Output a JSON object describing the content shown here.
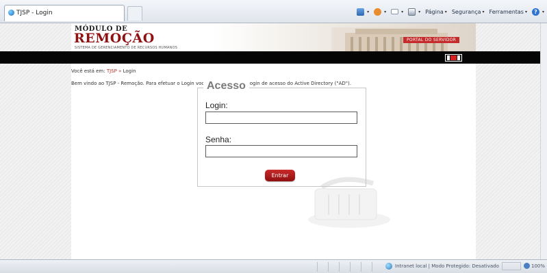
{
  "browser": {
    "tab_title": "TJSP - Login",
    "commands": [
      {
        "icon": "home-icon",
        "label": ""
      },
      {
        "icon": "feed-icon",
        "label": ""
      },
      {
        "icon": "mail-icon",
        "label": ""
      },
      {
        "icon": "print-icon",
        "label": ""
      },
      {
        "icon": "page-menu",
        "label": "Página"
      },
      {
        "icon": "security-menu",
        "label": "Segurança"
      },
      {
        "icon": "tools-menu",
        "label": "Ferramentas"
      },
      {
        "icon": "help-icon",
        "label": ""
      }
    ],
    "status": {
      "zone": "Intranet local | Modo Protegido: Desativado",
      "zoom": "100%"
    }
  },
  "header": {
    "logo_top": "MÓDULO DE",
    "logo_main": "REMOÇÃO",
    "logo_sub": "SISTEMA DE GERENCIAMENTO DE RECURSOS HUMANOS",
    "portal_badge": "PORTAL DO SERVIDOR"
  },
  "breadcrumb": {
    "prefix": "Você está em:",
    "link": "TJSP",
    "separator": "»",
    "current": "Login"
  },
  "welcome_text": "Bem vindo ao TJSP - Remoção. Para efetuar o Login você deve usar o seu login de acesso do Active Directory (\"AD\").",
  "login_form": {
    "legend": "Acesso",
    "login_label": "Login:",
    "login_value": "",
    "password_label": "Senha:",
    "password_value": "",
    "submit_label": "Entrar"
  },
  "colors": {
    "brand_red": "#8e1212",
    "button_red": "#b31d1d",
    "link_red": "#b8332c",
    "bar_black": "#050505"
  }
}
